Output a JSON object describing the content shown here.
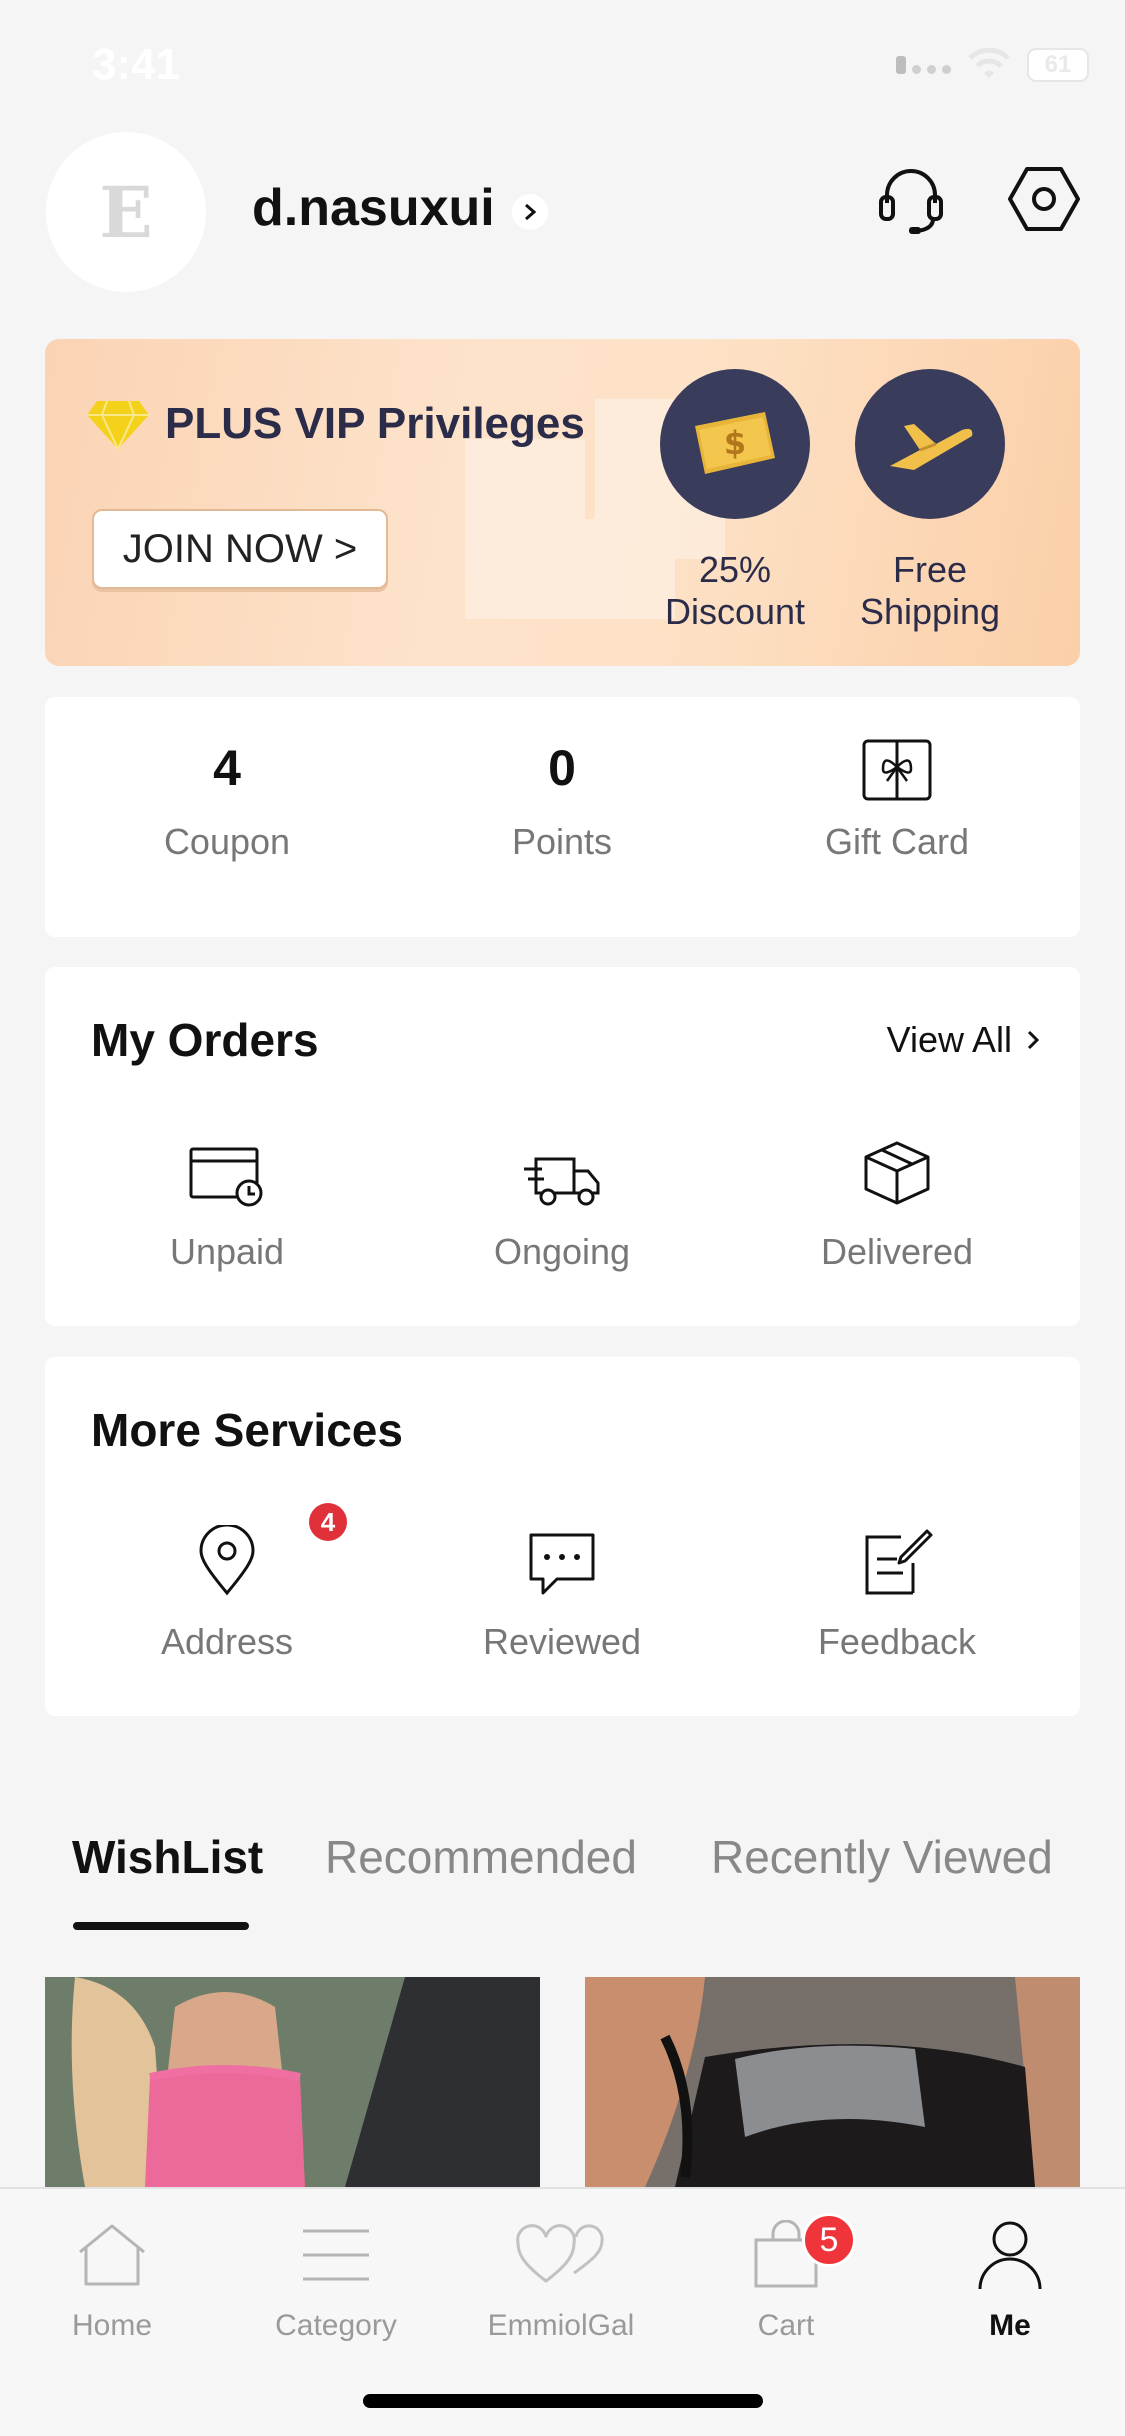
{
  "status_bar": {
    "time": "3:41",
    "battery": "61"
  },
  "profile": {
    "avatar_letter": "E",
    "username": "d.nasuxui"
  },
  "vip": {
    "title": "PLUS VIP Privileges",
    "join_label": "JOIN NOW >",
    "perks": [
      {
        "line1": "25%",
        "line2": "Discount",
        "icon": "coupon-ticket-icon"
      },
      {
        "line1": "Free",
        "line2": "Shipping",
        "icon": "airplane-icon"
      }
    ]
  },
  "stats": [
    {
      "value": "4",
      "label": "Coupon"
    },
    {
      "value": "0",
      "label": "Points"
    },
    {
      "label": "Gift Card",
      "icon": "gift-card-icon"
    }
  ],
  "orders": {
    "title": "My Orders",
    "view_all": "View All",
    "items": [
      {
        "label": "Unpaid",
        "icon": "unpaid-card-clock-icon"
      },
      {
        "label": "Ongoing",
        "icon": "delivery-truck-icon"
      },
      {
        "label": "Delivered",
        "icon": "package-box-icon"
      }
    ]
  },
  "services": {
    "title": "More Services",
    "items": [
      {
        "label": "Address",
        "badge": "4",
        "icon": "location-pin-icon"
      },
      {
        "label": "Reviewed",
        "icon": "chat-bubble-icon"
      },
      {
        "label": "Feedback",
        "icon": "edit-note-icon"
      }
    ]
  },
  "tabs": [
    "WishList",
    "Recommended",
    "Recently Viewed"
  ],
  "nav": [
    {
      "label": "Home",
      "icon": "home-icon"
    },
    {
      "label": "Category",
      "icon": "menu-lines-icon"
    },
    {
      "label": "EmmiolGal",
      "icon": "hearts-icon"
    },
    {
      "label": "Cart",
      "icon": "shopping-bag-icon",
      "badge": "5"
    },
    {
      "label": "Me",
      "icon": "person-icon",
      "active": true
    }
  ],
  "colors": {
    "accent_navy": "#3a3c5c",
    "badge_red": "#e0313a",
    "vip_bg": "#fde2c7"
  }
}
